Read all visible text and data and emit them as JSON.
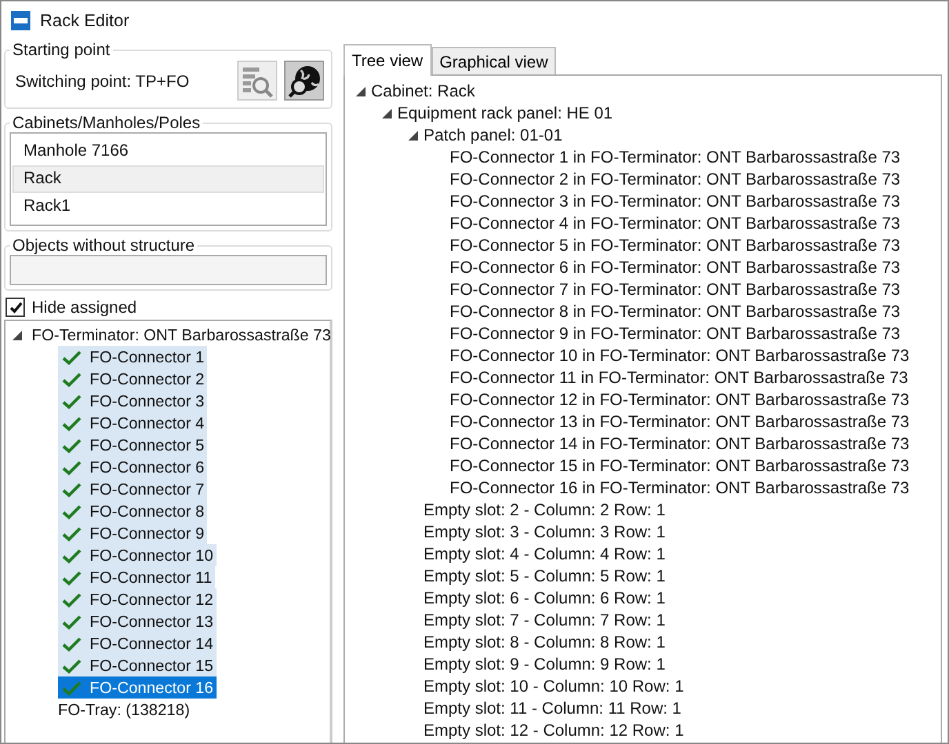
{
  "window": {
    "title": "Rack Editor"
  },
  "starting_point": {
    "label": "Starting point",
    "value": "Switching point: TP+FO"
  },
  "cabinets": {
    "label": "Cabinets/Manholes/Poles",
    "items": [
      {
        "label": "Manhole 7166",
        "selected": false
      },
      {
        "label": "Rack",
        "selected": true
      },
      {
        "label": "Rack1",
        "selected": false
      }
    ]
  },
  "objects_without_structure": {
    "label": "Objects without structure"
  },
  "hide_assigned": {
    "label": "Hide assigned",
    "checked": true
  },
  "left_tree": [
    {
      "label": "FO-Terminator: ONT Barbarossastraße 73",
      "expanded": true,
      "children": [
        {
          "label": "FO-Connector 1",
          "assigned": true,
          "selected": true,
          "focused": false
        },
        {
          "label": "FO-Connector 2",
          "assigned": true,
          "selected": true,
          "focused": false
        },
        {
          "label": "FO-Connector 3",
          "assigned": true,
          "selected": true,
          "focused": false
        },
        {
          "label": "FO-Connector 4",
          "assigned": true,
          "selected": true,
          "focused": false
        },
        {
          "label": "FO-Connector 5",
          "assigned": true,
          "selected": true,
          "focused": false
        },
        {
          "label": "FO-Connector 6",
          "assigned": true,
          "selected": true,
          "focused": false
        },
        {
          "label": "FO-Connector 7",
          "assigned": true,
          "selected": true,
          "focused": false
        },
        {
          "label": "FO-Connector 8",
          "assigned": true,
          "selected": true,
          "focused": false
        },
        {
          "label": "FO-Connector 9",
          "assigned": true,
          "selected": true,
          "focused": false
        },
        {
          "label": "FO-Connector 10",
          "assigned": true,
          "selected": true,
          "focused": false
        },
        {
          "label": "FO-Connector 11",
          "assigned": true,
          "selected": true,
          "focused": false
        },
        {
          "label": "FO-Connector 12",
          "assigned": true,
          "selected": true,
          "focused": false
        },
        {
          "label": "FO-Connector 13",
          "assigned": true,
          "selected": true,
          "focused": false
        },
        {
          "label": "FO-Connector 14",
          "assigned": true,
          "selected": true,
          "focused": false
        },
        {
          "label": "FO-Connector 15",
          "assigned": true,
          "selected": true,
          "focused": false
        },
        {
          "label": "FO-Connector 16",
          "assigned": true,
          "selected": true,
          "focused": true
        },
        {
          "label": "FO-Tray: (138218)",
          "assigned": false,
          "selected": false,
          "focused": false
        }
      ]
    }
  ],
  "tabs": [
    {
      "label": "Tree view",
      "selected": true
    },
    {
      "label": "Graphical view",
      "selected": false
    }
  ],
  "tree": [
    {
      "label": "Cabinet: Rack",
      "expanded": true,
      "children": [
        {
          "label": "Equipment rack panel: HE 01",
          "expanded": true,
          "children": [
            {
              "label": "Patch panel: 01-01",
              "expanded": true,
              "children": [
                {
                  "label": "FO-Connector 1 in FO-Terminator: ONT Barbarossastraße 73"
                },
                {
                  "label": "FO-Connector 2 in FO-Terminator: ONT Barbarossastraße 73"
                },
                {
                  "label": "FO-Connector 3 in FO-Terminator: ONT Barbarossastraße 73"
                },
                {
                  "label": "FO-Connector 4 in FO-Terminator: ONT Barbarossastraße 73"
                },
                {
                  "label": "FO-Connector 5 in FO-Terminator: ONT Barbarossastraße 73"
                },
                {
                  "label": "FO-Connector 6 in FO-Terminator: ONT Barbarossastraße 73"
                },
                {
                  "label": "FO-Connector 7 in FO-Terminator: ONT Barbarossastraße 73"
                },
                {
                  "label": "FO-Connector 8 in FO-Terminator: ONT Barbarossastraße 73"
                },
                {
                  "label": "FO-Connector 9 in FO-Terminator: ONT Barbarossastraße 73"
                },
                {
                  "label": "FO-Connector 10 in FO-Terminator: ONT Barbarossastraße 73"
                },
                {
                  "label": "FO-Connector 11 in FO-Terminator: ONT Barbarossastraße 73"
                },
                {
                  "label": "FO-Connector 12 in FO-Terminator: ONT Barbarossastraße 73"
                },
                {
                  "label": "FO-Connector 13 in FO-Terminator: ONT Barbarossastraße 73"
                },
                {
                  "label": "FO-Connector 14 in FO-Terminator: ONT Barbarossastraße 73"
                },
                {
                  "label": "FO-Connector 15 in FO-Terminator: ONT Barbarossastraße 73"
                },
                {
                  "label": "FO-Connector 16 in FO-Terminator: ONT Barbarossastraße 73"
                }
              ]
            },
            {
              "label": "Empty slot: 2 - Column: 2 Row: 1"
            },
            {
              "label": "Empty slot: 3 - Column: 3 Row: 1"
            },
            {
              "label": "Empty slot: 4 - Column: 4 Row: 1"
            },
            {
              "label": "Empty slot: 5 - Column: 5 Row: 1"
            },
            {
              "label": "Empty slot: 6 - Column: 6 Row: 1"
            },
            {
              "label": "Empty slot: 7 - Column: 7 Row: 1"
            },
            {
              "label": "Empty slot: 8 - Column: 8 Row: 1"
            },
            {
              "label": "Empty slot: 9 - Column: 9 Row: 1"
            },
            {
              "label": "Empty slot: 10 - Column: 10 Row: 1"
            },
            {
              "label": "Empty slot: 11 - Column: 11 Row: 1"
            },
            {
              "label": "Empty slot: 12 - Column: 12 Row: 1"
            }
          ]
        }
      ]
    }
  ]
}
